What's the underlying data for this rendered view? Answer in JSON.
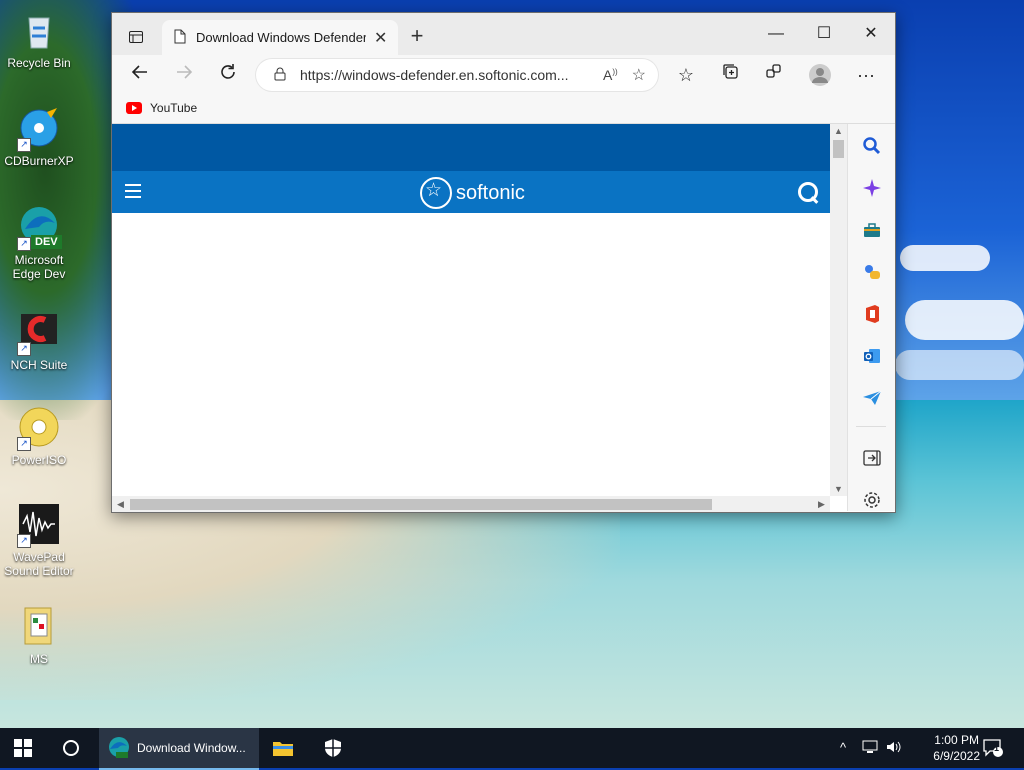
{
  "desktop": {
    "icons": [
      {
        "label": "Recycle Bin"
      },
      {
        "label": "CDBurnerXP"
      },
      {
        "label": "Microsoft Edge Dev"
      },
      {
        "label": "NCH Suite"
      },
      {
        "label": "PowerISO"
      },
      {
        "label": "WavePad Sound Editor"
      },
      {
        "label": "MS"
      }
    ],
    "edge_badge": "DEV"
  },
  "browser": {
    "tab_title": "Download Windows Defender - S",
    "address_url": "https://windows-defender.en.softonic.com...",
    "favorites": [
      {
        "label": "YouTube"
      }
    ],
    "page": {
      "brand": "softonic",
      "brand_color": "#0a73c3",
      "band_color": "#0058a3"
    }
  },
  "taskbar": {
    "active_app_label": "Download Window...",
    "clock_time": "1:00 PM",
    "clock_date": "6/9/2022",
    "notification_count": "1"
  }
}
